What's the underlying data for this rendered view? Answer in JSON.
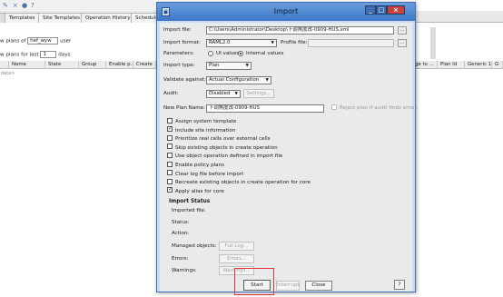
{
  "background": {
    "tabs": [
      "Templates",
      "Site Templates",
      "Operation History",
      "Scheduled"
    ],
    "filter_row1": {
      "prefix": "w plans of",
      "value": "hef_wyw",
      "suffix": "user"
    },
    "filter_row2": {
      "prefix": "w plans for last",
      "value": "1",
      "suffix": "days"
    },
    "columns_left": [
      "Name",
      "State",
      "Group",
      "Enable p...",
      "Create"
    ],
    "columns_right": [
      "rge to ...",
      "Plan Id",
      "Generic 1",
      "G"
    ],
    "nodata": "data>"
  },
  "dialog": {
    "title": "Import",
    "import_file_label": "Import file:",
    "import_file_value": "C:\\Users\\Administrator\\Desktop\\下调角度改-0909-HUS.xml",
    "browse_label": "...",
    "import_format_label": "Import format:",
    "import_format_value": "RAML2.0",
    "profile_file_label": "Profile file:",
    "parameters_label": "Parameters:",
    "param_ui_values": "UI values",
    "param_internal_values": "Internal values",
    "import_type_label": "Import type:",
    "import_type_value": "Plan",
    "validate_against_label": "Validate against:",
    "validate_against_value": "Actual Configuration",
    "audit_label": "Audit:",
    "audit_value": "Disabled",
    "settings_label": "Settings...",
    "new_plan_name_label": "New Plan Name:",
    "new_plan_name_value": "下调角度改-0909-HUS",
    "reject_label": "Reject plan if audit finds errors",
    "checkboxes": [
      {
        "label": "Assign system template",
        "checked": false,
        "disabled": false
      },
      {
        "label": "Include site information",
        "checked": true,
        "disabled": false
      },
      {
        "label": "Prioritize real cells over external cells",
        "checked": false,
        "disabled": false
      },
      {
        "label": "Skip existing objects in create operation",
        "checked": false,
        "disabled": false
      },
      {
        "label": "Use object operation defined in import file",
        "checked": false,
        "disabled": false
      },
      {
        "label": "Enable policy plans",
        "checked": false,
        "disabled": false
      },
      {
        "label": "Clear log file before import",
        "checked": false,
        "disabled": false
      },
      {
        "label": "Recreate existing objects in create operation for core",
        "checked": false,
        "disabled": false
      },
      {
        "label": "Apply alias for core",
        "checked": true,
        "disabled": false
      }
    ],
    "import_status": {
      "title": "Import Status",
      "imported_file": "Imported file:",
      "status": "Status:",
      "action": "Action:",
      "managed_objects": "Managed objects:",
      "full_log": "Full Log...",
      "errors": "Errors:",
      "errors_btn": "Errors...",
      "warnings": "Warnings:",
      "warnings_btn": "Warnings..."
    },
    "footer": {
      "start": "Start",
      "interrupt": "Interrupt",
      "close": "Close",
      "help": "?"
    },
    "accent_color": "#3b78c9",
    "highlight_color": "#e23636"
  }
}
